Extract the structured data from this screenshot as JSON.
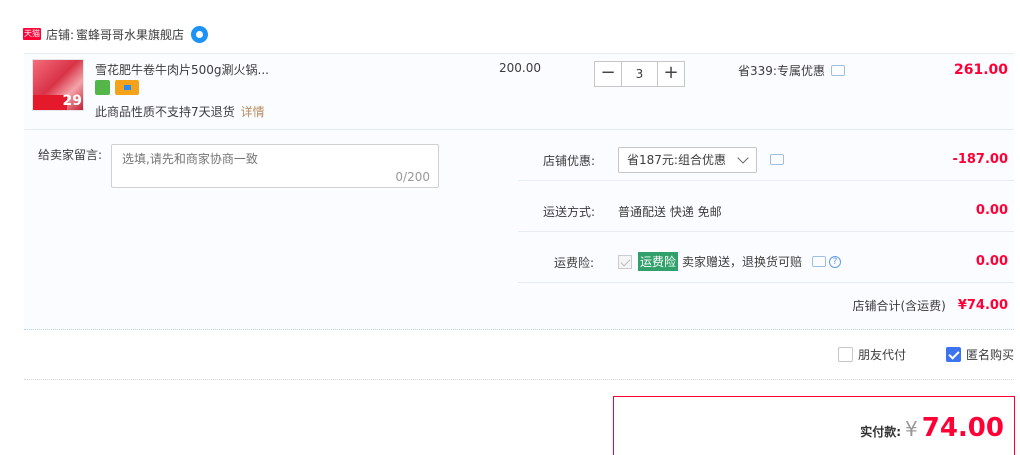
{
  "shop": {
    "badge": "天猫",
    "label": "店铺:",
    "name": "蜜蜂哥哥水果旗舰店"
  },
  "item": {
    "thumb_price": "29",
    "title": "雪花肥牛卷牛肉片500g涮火锅...",
    "note": "此商品性质不支持7天退货",
    "detail_link": "详情",
    "unit_price": "200.00",
    "quantity": "3",
    "promo": "省339:专属优惠",
    "total": "261.00"
  },
  "message": {
    "label": "给卖家留言:",
    "placeholder": "选填,请先和商家协商一致",
    "count": "0/200"
  },
  "shop_discount": {
    "label": "店铺优惠:",
    "selected": "省187元:组合优惠",
    "value": "-187.00"
  },
  "shipping": {
    "label": "运送方式:",
    "text": "普通配送 快递 免邮",
    "value": "0.00"
  },
  "insurance": {
    "label": "运费险:",
    "badge": "运费险",
    "text": "卖家赠送，退换货可赔",
    "value": "0.00"
  },
  "subtotal": {
    "label": "店铺合计(含运费)",
    "value": "¥74.00"
  },
  "options": {
    "friend_pay": "朋友代付",
    "friend_pay_checked": false,
    "anonymous": "匿名购买",
    "anonymous_checked": true
  },
  "payment": {
    "label": "实付款:",
    "currency": "¥",
    "value": "74.00"
  },
  "colors": {
    "accent": "#ff0036",
    "band_bg": "#fbfcff",
    "checkbox": "#3b74ee"
  }
}
